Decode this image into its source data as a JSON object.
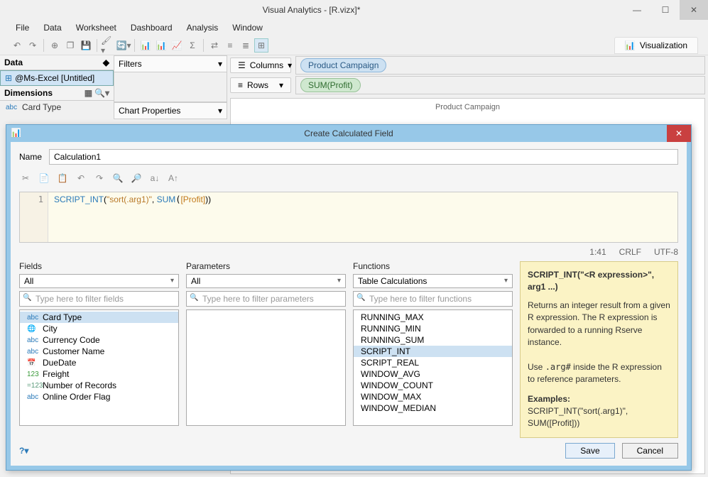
{
  "window": {
    "title": "Visual Analytics - [R.vizx]*"
  },
  "menu": [
    "File",
    "Data",
    "Worksheet",
    "Dashboard",
    "Analysis",
    "Window"
  ],
  "vis_tab": "Visualization",
  "data_panel": {
    "header": "Data",
    "datasource": "@Ms-Excel [Untitled]",
    "dimensions_header": "Dimensions",
    "items": [
      {
        "icon": "abc",
        "label": "Card Type"
      }
    ]
  },
  "mid": {
    "filters": "Filters",
    "chart_properties": "Chart Properties"
  },
  "shelves": {
    "columns_label": "Columns",
    "columns_pill": "Product Campaign",
    "rows_label": "Rows",
    "rows_pill": "SUM(Profit)"
  },
  "chart": {
    "toplabel": "Product Campaign"
  },
  "dialog": {
    "title": "Create Calculated Field",
    "name_label": "Name",
    "name_value": "Calculation1",
    "code_line_no": "1",
    "code": {
      "fn": "SCRIPT_INT",
      "open": "(",
      "str": "\"sort(.arg1)\"",
      "sep": ", ",
      "agg": "SUM",
      "field": "[Profit]",
      "close": ")",
      "close2": ")"
    },
    "status": {
      "pos": "1:41",
      "eol": "CRLF",
      "enc": "UTF-8"
    },
    "fields": {
      "label": "Fields",
      "combo": "All",
      "filter_placeholder": "Type here to filter fields",
      "items": [
        {
          "icon": "abc",
          "label": "Card Type",
          "selected": true
        },
        {
          "icon": "globe",
          "label": "City"
        },
        {
          "icon": "abc",
          "label": "Currency Code"
        },
        {
          "icon": "abc",
          "label": "Customer Name"
        },
        {
          "icon": "cal",
          "label": "DueDate"
        },
        {
          "icon": "num",
          "label": "Freight"
        },
        {
          "icon": "calc",
          "label": "Number of Records"
        },
        {
          "icon": "abc",
          "label": "Online Order Flag"
        }
      ]
    },
    "parameters": {
      "label": "Parameters",
      "combo": "All",
      "filter_placeholder": "Type here to filter parameters"
    },
    "functions": {
      "label": "Functions",
      "combo": "Table Calculations",
      "filter_placeholder": "Type here to filter functions",
      "items": [
        {
          "label": "RUNNING_MAX"
        },
        {
          "label": "RUNNING_MIN"
        },
        {
          "label": "RUNNING_SUM"
        },
        {
          "label": "SCRIPT_INT",
          "selected": true
        },
        {
          "label": "SCRIPT_REAL"
        },
        {
          "label": "WINDOW_AVG"
        },
        {
          "label": "WINDOW_COUNT"
        },
        {
          "label": "WINDOW_MAX"
        },
        {
          "label": "WINDOW_MEDIAN"
        }
      ]
    },
    "help": {
      "sig": "SCRIPT_INT(\"<R expression>\", arg1 ...)",
      "body1": "Returns an integer result from a given R expression. The R expression is forwarded to a running Rserve instance.",
      "body2a": "Use ",
      "body2code": ".arg#",
      "body2b": " inside the R expression to reference parameters.",
      "examples_label": "Examples:",
      "example": "SCRIPT_INT(\"sort(.arg1)\", SUM([Profit]))"
    },
    "help_icon": "?",
    "save": "Save",
    "cancel": "Cancel"
  }
}
